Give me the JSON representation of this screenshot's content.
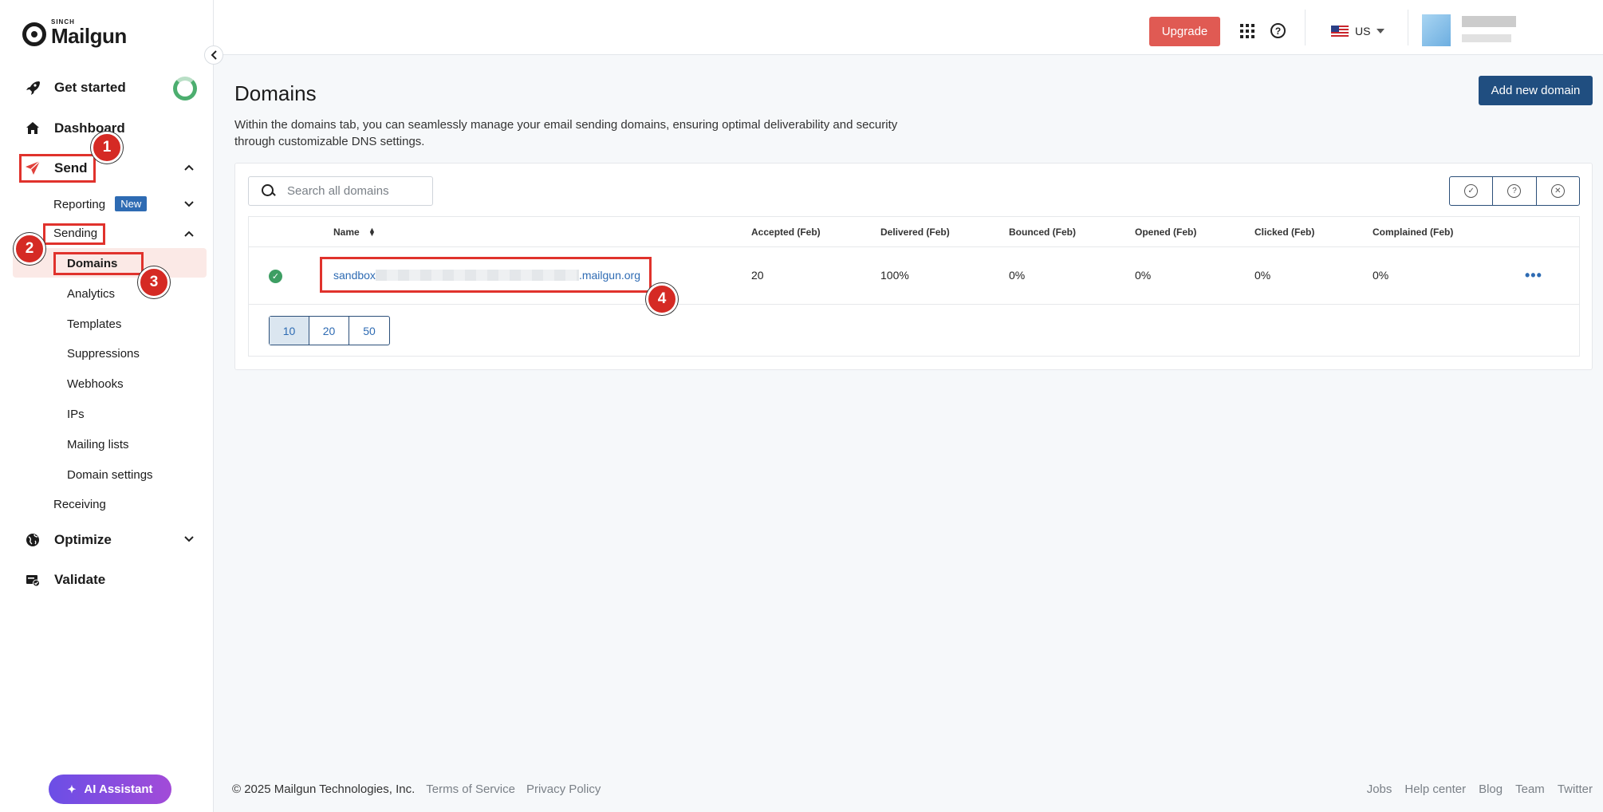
{
  "brand": {
    "sinch": "SINCH",
    "name": "Mailgun"
  },
  "sidebar": {
    "items": [
      {
        "label": "Get started"
      },
      {
        "label": "Dashboard"
      },
      {
        "label": "Send"
      },
      {
        "label": "Optimize"
      },
      {
        "label": "Validate"
      }
    ],
    "send_sub": {
      "reporting": "Reporting",
      "reporting_badge": "New",
      "sending": "Sending",
      "receiving": "Receiving"
    },
    "sending_sub": [
      "Domains",
      "Analytics",
      "Templates",
      "Suppressions",
      "Webhooks",
      "IPs",
      "Mailing lists",
      "Domain settings"
    ],
    "ai_assistant": "AI Assistant"
  },
  "topbar": {
    "upgrade": "Upgrade",
    "region": "US"
  },
  "main": {
    "title": "Domains",
    "description": "Within the domains tab, you can seamlessly manage your email sending domains, ensuring optimal deliverability and security through customizable DNS settings.",
    "add_button": "Add new domain",
    "search_placeholder": "Search all domains",
    "columns": [
      "Name",
      "Accepted (Feb)",
      "Delivered (Feb)",
      "Bounced (Feb)",
      "Opened (Feb)",
      "Clicked (Feb)",
      "Complained (Feb)"
    ],
    "rows": [
      {
        "domain_prefix": "sandbox",
        "domain_suffix": ".mailgun.org",
        "accepted": "20",
        "delivered": "100%",
        "bounced": "0%",
        "opened": "0%",
        "clicked": "0%",
        "complained": "0%"
      }
    ],
    "page_sizes": [
      "10",
      "20",
      "50"
    ]
  },
  "annotations": [
    "1",
    "2",
    "3",
    "4"
  ],
  "footer": {
    "copyright": "© 2025 Mailgun Technologies, Inc.",
    "terms": "Terms of Service",
    "privacy": "Privacy Policy",
    "links": [
      "Jobs",
      "Help center",
      "Blog",
      "Team",
      "Twitter"
    ]
  },
  "colors": {
    "upgrade": "#e05a53",
    "primary": "#204e80",
    "link": "#2e6bb3",
    "annotation": "#e0322c",
    "success": "#3d9e63"
  }
}
